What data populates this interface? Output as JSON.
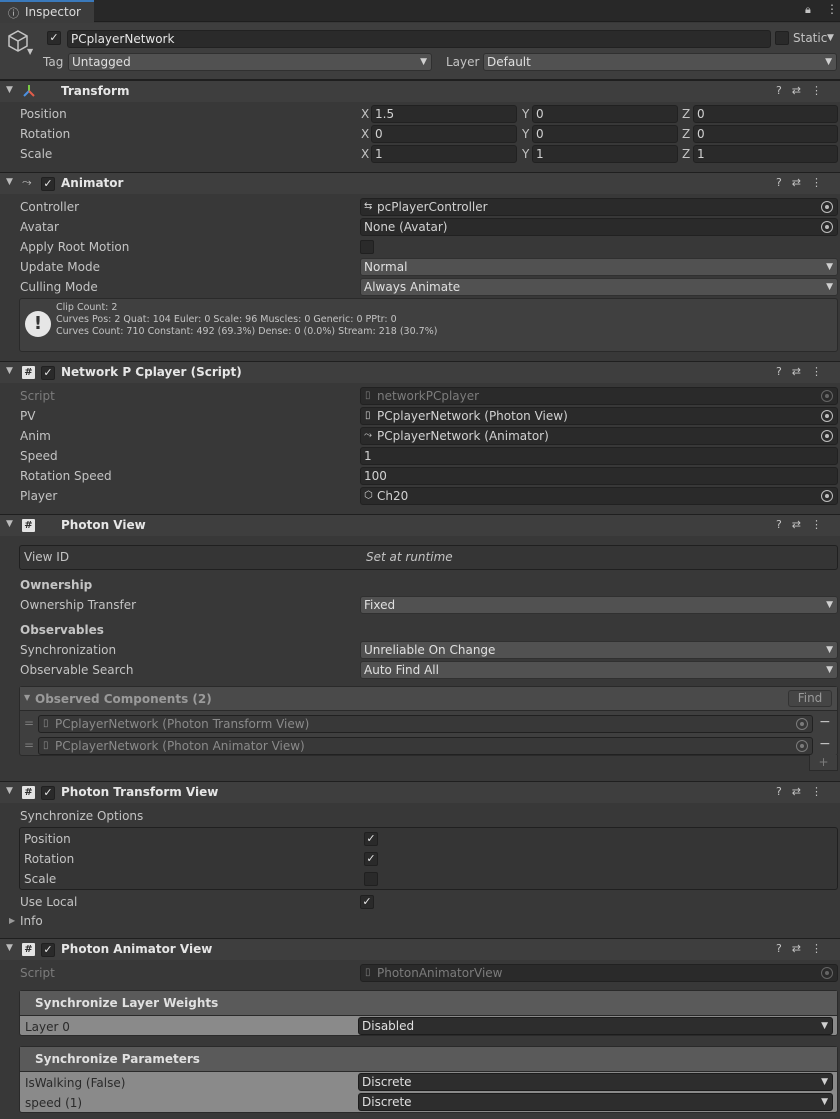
{
  "tab": {
    "title": "Inspector"
  },
  "gameobject": {
    "name": "PCplayerNetwork",
    "static_label": "Static",
    "tag_label": "Tag",
    "tag_value": "Untagged",
    "layer_label": "Layer",
    "layer_value": "Default"
  },
  "transform": {
    "title": "Transform",
    "position_label": "Position",
    "rotation_label": "Rotation",
    "scale_label": "Scale",
    "position": {
      "x": "1.5",
      "y": "0",
      "z": "0"
    },
    "rotation": {
      "x": "0",
      "y": "0",
      "z": "0"
    },
    "scale": {
      "x": "1",
      "y": "1",
      "z": "1"
    },
    "axis_x": "X",
    "axis_y": "Y",
    "axis_z": "Z"
  },
  "animator": {
    "title": "Animator",
    "controller_label": "Controller",
    "controller_value": "pcPlayerController",
    "avatar_label": "Avatar",
    "avatar_value": "None (Avatar)",
    "root_motion_label": "Apply Root Motion",
    "update_mode_label": "Update Mode",
    "update_mode_value": "Normal",
    "culling_mode_label": "Culling Mode",
    "culling_mode_value": "Always Animate",
    "info_line1": "Clip Count: 2",
    "info_line2": "Curves Pos: 2 Quat: 104 Euler: 0 Scale: 96 Muscles: 0 Generic: 0 PPtr: 0",
    "info_line3": "Curves Count: 710 Constant: 492 (69.3%) Dense: 0 (0.0%) Stream: 218 (30.7%)"
  },
  "network_script": {
    "title": "Network P Cplayer (Script)",
    "script_label": "Script",
    "script_value": "networkPCplayer",
    "pv_label": "PV",
    "pv_value": "PCplayerNetwork (Photon View)",
    "anim_label": "Anim",
    "anim_value": "PCplayerNetwork (Animator)",
    "speed_label": "Speed",
    "speed_value": "1",
    "rotation_speed_label": "Rotation Speed",
    "rotation_speed_value": "100",
    "player_label": "Player",
    "player_value": "Ch20"
  },
  "photon_view": {
    "title": "Photon View",
    "view_id_label": "View ID",
    "view_id_value": "Set at runtime",
    "ownership_heading": "Ownership",
    "ownership_transfer_label": "Ownership Transfer",
    "ownership_transfer_value": "Fixed",
    "observables_heading": "Observables",
    "synchronization_label": "Synchronization",
    "synchronization_value": "Unreliable On Change",
    "observable_search_label": "Observable Search",
    "observable_search_value": "Auto Find All",
    "observed_title": "Observed Components (2)",
    "find_label": "Find",
    "observed_items": [
      "PCplayerNetwork (Photon Transform View)",
      "PCplayerNetwork (Photon Animator View)"
    ]
  },
  "photon_transform": {
    "title": "Photon Transform View",
    "sync_options_label": "Synchronize Options",
    "position_label": "Position",
    "rotation_label": "Rotation",
    "scale_label": "Scale",
    "use_local_label": "Use Local",
    "info_label": "Info"
  },
  "photon_animator": {
    "title": "Photon Animator View",
    "script_label": "Script",
    "script_value": "PhotonAnimatorView",
    "layer_weights_title": "Synchronize Layer Weights",
    "layer0_label": "Layer 0",
    "layer0_value": "Disabled",
    "params_title": "Synchronize Parameters",
    "param1_label": "IsWalking (False)",
    "param1_value": "Discrete",
    "param2_label": "speed (1)",
    "param2_value": "Discrete"
  },
  "check_mark": "✓",
  "colors": {
    "background": "#383838",
    "field": "#2a2a2a",
    "header": "#3e3e3e"
  }
}
